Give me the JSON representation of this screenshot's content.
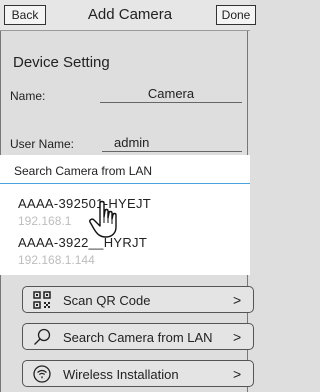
{
  "navbar": {
    "back_label": "Back",
    "title": "Add Camera",
    "done_label": "Done"
  },
  "device_setting": {
    "title": "Device Setting",
    "name_label": "Name:",
    "name_value": "Camera",
    "user_label": "User Name:",
    "user_value": "admin"
  },
  "search_popup": {
    "title": "Search Camera from LAN",
    "cameras": [
      {
        "id": "AAAA-392501-HYEJT",
        "ip": "192.168.1"
      },
      {
        "id": "AAAA-3922__HYRJT",
        "ip": "192.168.1.144"
      }
    ]
  },
  "menu": [
    {
      "label": "Scan QR Code",
      "icon": "qr-code-icon",
      "chevron": ">"
    },
    {
      "label": "Search Camera from LAN",
      "icon": "search-icon",
      "chevron": ">"
    },
    {
      "label": "Wireless Installation",
      "icon": "wireless-icon",
      "chevron": ">"
    }
  ],
  "colors": {
    "accent_line": "#4aa3df",
    "background": "#dedede",
    "ip_text": "#bdbdbd"
  }
}
